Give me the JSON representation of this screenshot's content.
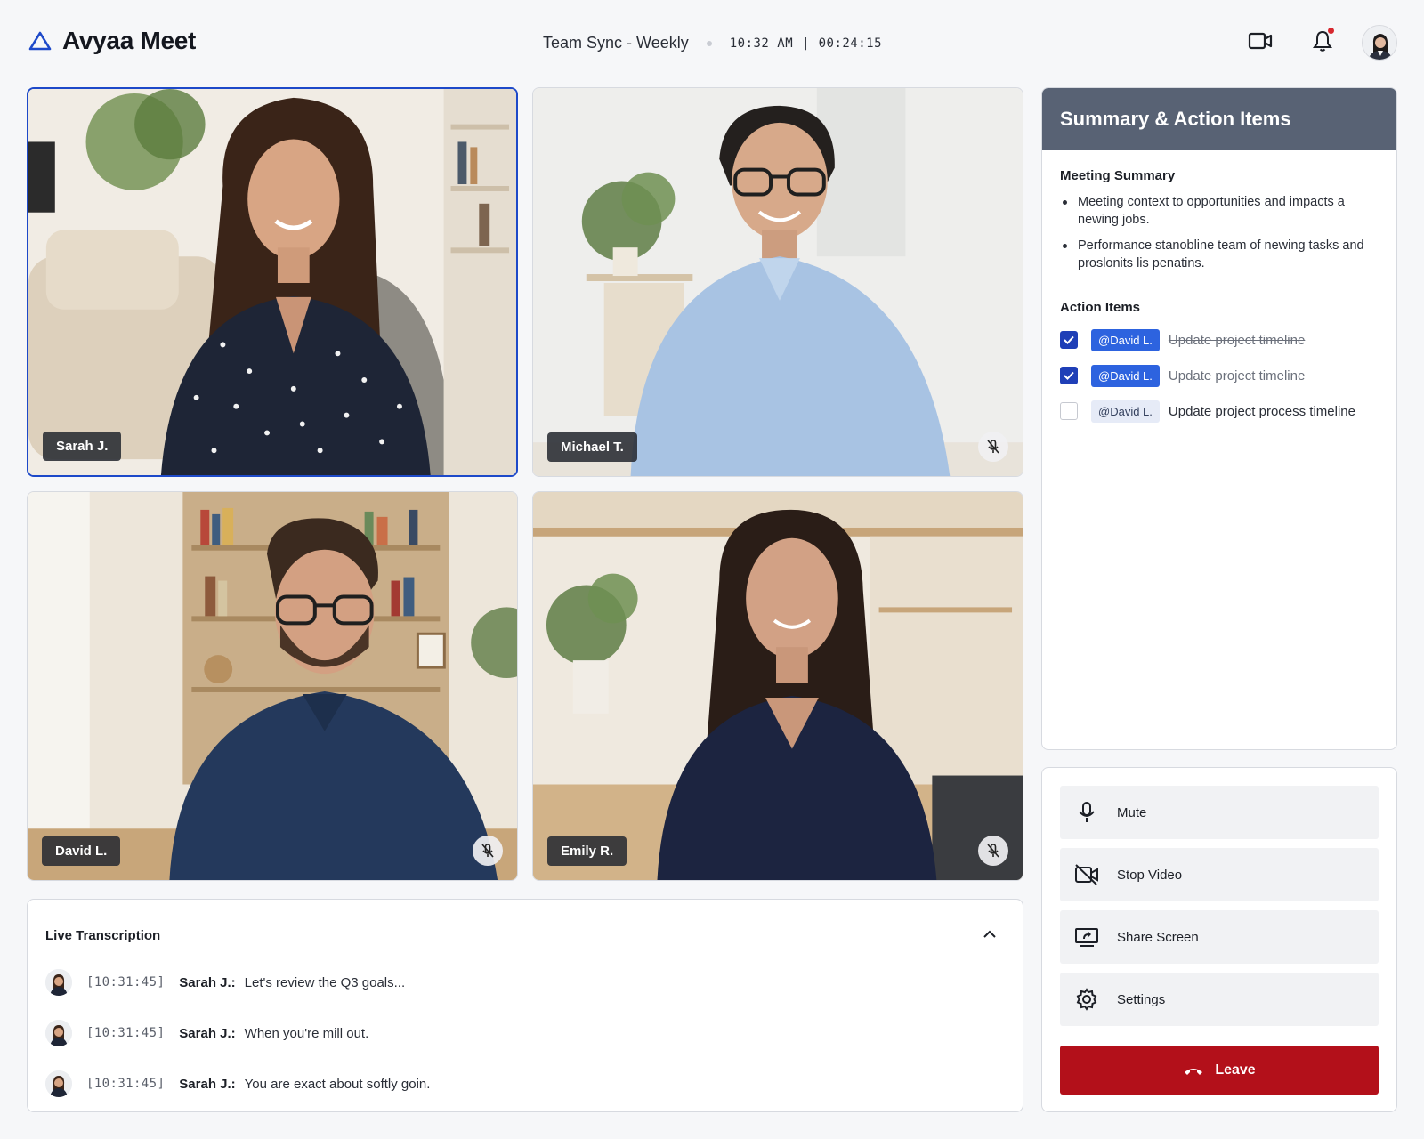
{
  "app": {
    "name": "Avyaa Meet"
  },
  "meeting": {
    "title": "Team Sync - Weekly",
    "clock": "10:32 AM",
    "separator": "|",
    "elapsed": "00:24:15"
  },
  "header": {
    "icons": [
      "video-camera-icon",
      "bell-icon",
      "user-avatar"
    ],
    "notification_badge": true
  },
  "participants": [
    {
      "name": "Sarah J.",
      "active_speaker": true,
      "muted": false
    },
    {
      "name": "Michael T.",
      "active_speaker": false,
      "muted": true
    },
    {
      "name": "David L.",
      "active_speaker": false,
      "muted": true
    },
    {
      "name": "Emily R.",
      "active_speaker": false,
      "muted": true
    }
  ],
  "transcription": {
    "title": "Live Transcription",
    "lines": [
      {
        "time": "[10:31:45]",
        "speaker": "Sarah J.:",
        "text": "Let's review the Q3 goals..."
      },
      {
        "time": "[10:31:45]",
        "speaker": "Sarah J.:",
        "text": "When you're mill out."
      },
      {
        "time": "[10:31:45]",
        "speaker": "Sarah J.:",
        "text": "You are exact about softly goin."
      }
    ]
  },
  "summary": {
    "title": "Summary & Action Items",
    "meeting_summary_label": "Meeting Summary",
    "bullets": [
      "Meeting context to opportunities and impacts a newing jobs.",
      "Performance stanobline team of newing tasks and proslonits lis penatins."
    ],
    "action_items_label": "Action Items",
    "actions": [
      {
        "checked": true,
        "mention": "@David L.",
        "text": "Update project timeline"
      },
      {
        "checked": true,
        "mention": "@David L.",
        "text": "Update project timeline"
      },
      {
        "checked": false,
        "mention": "@David L.",
        "text": "Update project process timeline"
      }
    ]
  },
  "controls": {
    "mute": "Mute",
    "stop_video": "Stop Video",
    "share_screen": "Share Screen",
    "settings": "Settings",
    "leave": "Leave"
  },
  "colors": {
    "accent": "#1d49c9",
    "summary_header": "#586274",
    "leave": "#b3101a",
    "mention": "#2d63df"
  }
}
